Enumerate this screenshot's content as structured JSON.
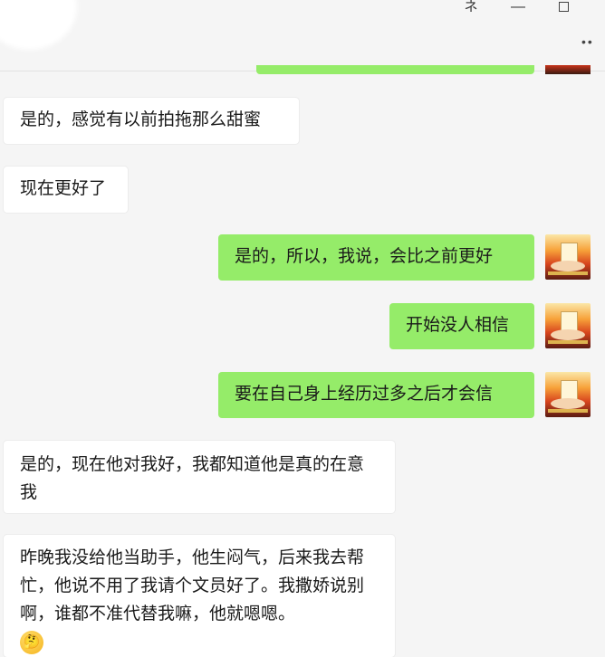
{
  "window": {
    "pin_icon": "pin-icon",
    "minimize_icon": "minimize-icon",
    "maximize_icon": "maximize-icon",
    "more_icon": "more-icon",
    "pin_glyph": "ネ",
    "minimize_glyph": "—",
    "more_glyph": "••"
  },
  "colors": {
    "sent_bubble": "#95ec69",
    "received_bubble": "#ffffff",
    "background": "#f5f5f5"
  },
  "messages": [
    {
      "side": "left",
      "text": "是的，感觉有以前拍拖那么甜蜜"
    },
    {
      "side": "left",
      "text": "现在更好了"
    },
    {
      "side": "right",
      "text": "是的，所以，我说，会比之前更好"
    },
    {
      "side": "right",
      "text": "开始没人相信"
    },
    {
      "side": "right",
      "text": "要在自己身上经历过多之后才会信"
    },
    {
      "side": "left",
      "text": "是的，现在他对我好，我都知道他是真的在意我"
    },
    {
      "side": "left",
      "text": "昨晚我没给他当助手，他生闷气，后来我去帮忙，他说不用了我请个文员好了。我撒娇说别啊，谁都不准代替我嘛，他就嗯嗯。",
      "emoji": "thinking-emoji"
    }
  ]
}
